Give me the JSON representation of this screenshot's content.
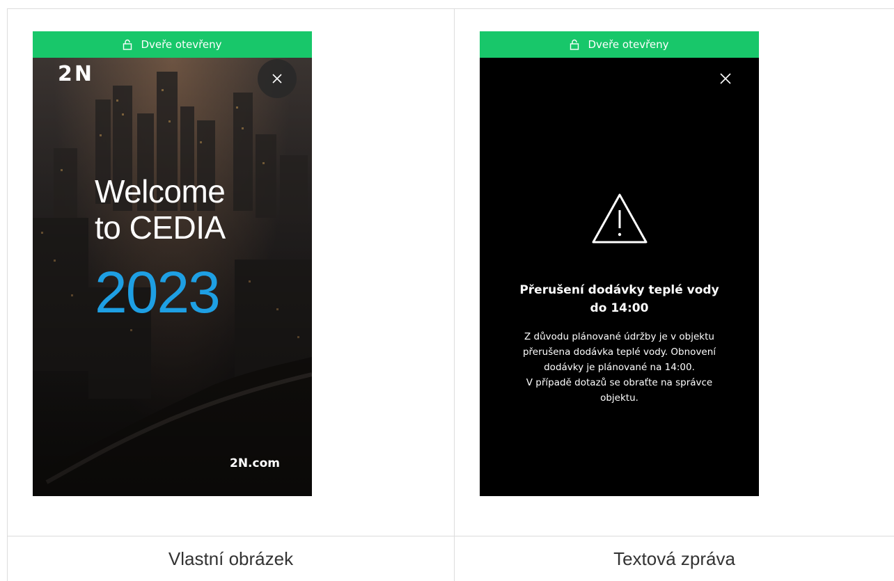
{
  "left": {
    "status": "Dveře otevřeny",
    "logo": "2N",
    "welcome_line1": "Welcome",
    "welcome_line2": "to CEDIA",
    "year": "2023",
    "site": "2N.com",
    "caption": "Vlastní obrázek"
  },
  "right": {
    "status": "Dveře otevřeny",
    "title_line1": "Přerušení dodávky teplé vody",
    "title_line2": "do 14:00",
    "body_lines": [
      "Z důvodu plánované údržby je v objektu",
      "přerušena dodávka teplé vody. Obnovení",
      "dodávky je plánované na 14:00.",
      "V případě dotazů se obraťte na správce",
      "objektu."
    ],
    "caption": "Textová zpráva"
  },
  "colors": {
    "status_green": "#18c76a",
    "year_blue": "#1e9fe3"
  },
  "icons": [
    "lock-open-icon",
    "close-icon",
    "warning-icon"
  ]
}
